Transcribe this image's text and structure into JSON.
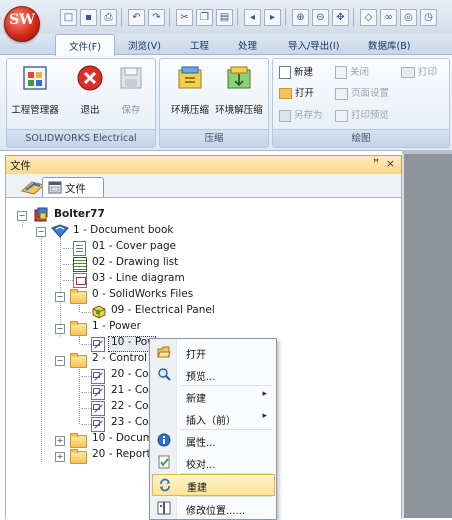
{
  "ribbon_tabs": [
    "文件(F)",
    "浏览(V)",
    "工程",
    "处理",
    "导入/导出(I)",
    "数据库(B)"
  ],
  "ribbon": {
    "app_logo_text": "SW",
    "group_project": {
      "label": "SOLIDWORKS Electrical",
      "buttons": [
        "工程管理器",
        "退出",
        "保存"
      ]
    },
    "group_compress": {
      "label": "压缩",
      "buttons": [
        "环境压缩",
        "环境解压缩"
      ]
    },
    "group_drawing": {
      "label": "绘图",
      "col1": [
        "新建",
        "打开",
        "另存为"
      ],
      "col2": [
        "关闭",
        "页面设置",
        "打印预览"
      ],
      "col3": [
        "打印"
      ]
    }
  },
  "panel": {
    "title": "文件",
    "pin_glyph": "ꟸ",
    "close_glyph": "×",
    "doc_tab_label": "文件"
  },
  "tree": {
    "root": "Bolter77",
    "document_book": "1 - Document book",
    "items": [
      "01 - Cover page",
      "02 - Drawing list",
      "03 - Line diagram",
      "0 - SolidWorks Files",
      "09 - Electrical Panel",
      "1 - Power",
      "10 - Pow",
      "2 - Control",
      "20 - Cor",
      "21 - Cor",
      "22 - Cor",
      "23 - Cor",
      "10 - Docume",
      "20 - Reports"
    ]
  },
  "context_menu": {
    "items": [
      "打开",
      "预览...",
      "新建",
      "插入（前）",
      "属性...",
      "校对...",
      "重建",
      "修改位置......"
    ],
    "highlighted": "重建"
  },
  "colors": {
    "ribbon_accent": "#15325e",
    "panel_header": "#fbd990",
    "highlight": "#fde49b",
    "right_strip": "#8f939a"
  }
}
